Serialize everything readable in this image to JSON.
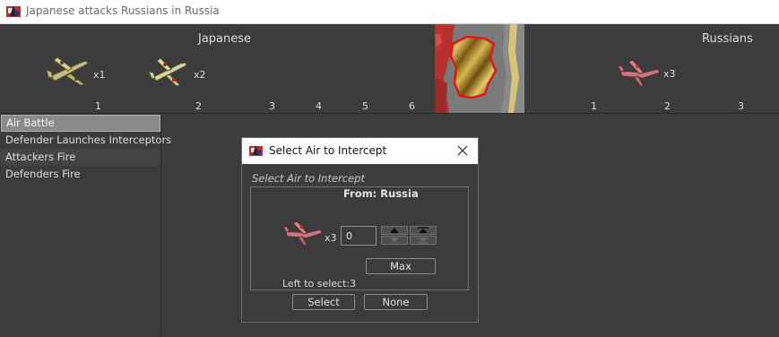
{
  "window": {
    "title": "Japanese attacks Russians in Russia",
    "app_icon": "game-map-icon"
  },
  "battle": {
    "attacker": {
      "label": "Japanese",
      "units": [
        {
          "icon": "bomber-plane-icon",
          "count": "x1"
        },
        {
          "icon": "fighter-plane-icon",
          "count": "x2"
        }
      ],
      "dice": [
        "1",
        "2",
        "3",
        "4",
        "5",
        "6"
      ]
    },
    "territory": {
      "name": "Russia",
      "icon": "territory-map-icon"
    },
    "defender": {
      "label": "Russians",
      "units": [
        {
          "icon": "red-fighter-plane-icon",
          "count": "x3"
        }
      ],
      "dice": [
        "1",
        "2",
        "3"
      ]
    }
  },
  "steps": [
    {
      "label": "Air Battle",
      "selected": true
    },
    {
      "label": "Defender Launches Interceptors",
      "selected": false
    },
    {
      "label": "Attackers Fire",
      "selected": false
    },
    {
      "label": "Defenders Fire",
      "selected": false
    }
  ],
  "dialog": {
    "title": "Select Air to Intercept",
    "subtitle": "Select Air to Intercept",
    "from": "From: Russia",
    "unit": {
      "icon": "red-fighter-plane-icon",
      "count": "x3",
      "value": "0"
    },
    "max_label": "Max",
    "left_to_select": "Left to select:3",
    "select_label": "Select",
    "none_label": "None"
  },
  "colors": {
    "background": "#3c3c3c",
    "text": "#dcdcdc",
    "selected_step": "#8a8a8a",
    "territory_border": "#e01818"
  }
}
